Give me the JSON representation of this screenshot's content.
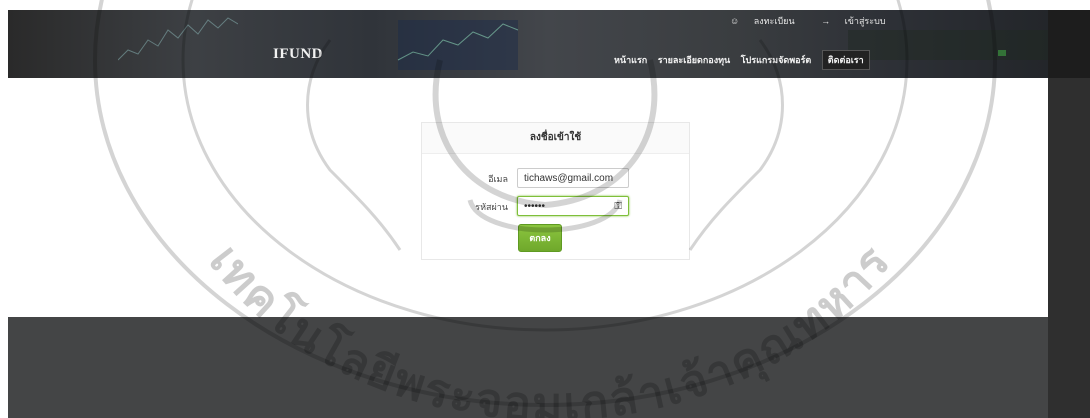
{
  "header": {
    "brand": "IFUND",
    "top_links": [
      {
        "icon": "user-icon",
        "label": "ลงทะเบียน"
      },
      {
        "icon": "login-icon",
        "label": "เข้าสู่ระบบ"
      }
    ],
    "nav": [
      {
        "label": "หน้าแรก"
      },
      {
        "label": "รายละเอียดกองทุน"
      },
      {
        "label": "โปรแกรมจัดพอร์ต"
      },
      {
        "label": "ติดต่อเรา"
      }
    ]
  },
  "login": {
    "title": "ลงชื่อเข้าใช้",
    "email_label": "อีเมล",
    "email_value": "tichaws@gmail.com",
    "password_label": "รหัสผ่าน",
    "password_value": "••••••",
    "submit_label": "ตกลง"
  },
  "watermark": {
    "text": "เทคโนโลยีพระจอมเกล้าเจ้าคุณทหาร"
  },
  "colors": {
    "accent": "#7fbf3a",
    "footer": "#444546",
    "header_dark": "#2d3036"
  }
}
